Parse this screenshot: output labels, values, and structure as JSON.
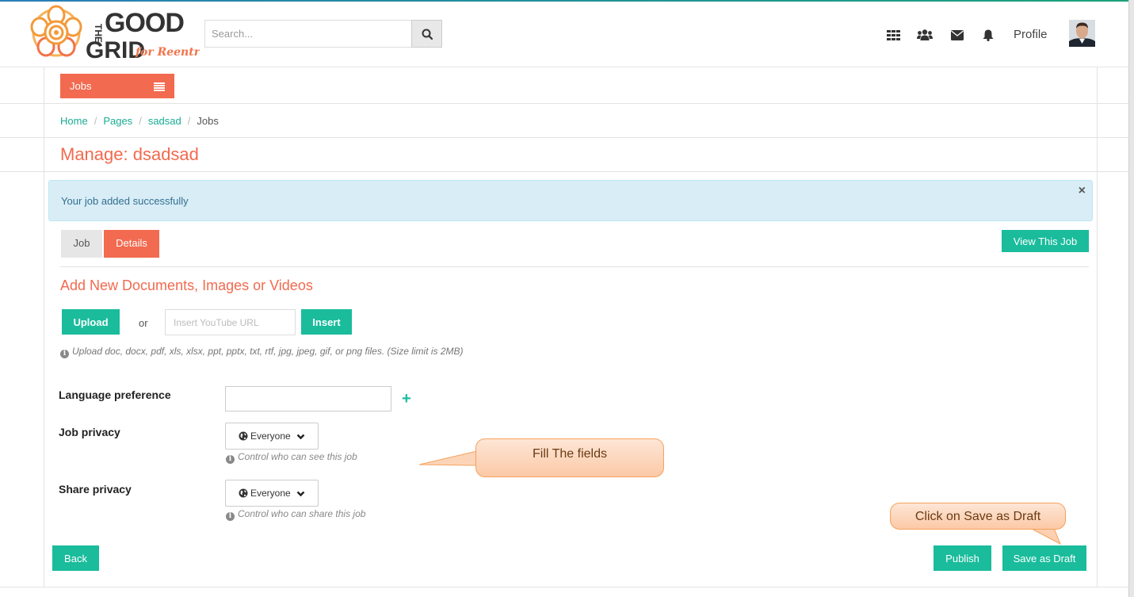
{
  "header": {
    "logo": {
      "line1": "THE",
      "line2": "GOOD",
      "line3": "GRID",
      "tagline": "for Reentry"
    },
    "search": {
      "placeholder": "Search..."
    },
    "icons": [
      "apps-grid-icon",
      "users-icon",
      "envelope-icon",
      "bell-icon",
      "search-icon"
    ],
    "profile_label": "Profile"
  },
  "menu": {
    "jobs_label": "Jobs"
  },
  "breadcrumb": {
    "home": "Home",
    "pages": "Pages",
    "page": "sadsad",
    "current": "Jobs",
    "separator": "/"
  },
  "page_title": "Manage: dsadsad",
  "alert": {
    "message": "Your job added successfully",
    "close": "×"
  },
  "tabs": {
    "job": "Job",
    "details": "Details",
    "view_button": "View This Job"
  },
  "media": {
    "title": "Add New Documents, Images or Videos",
    "upload_label": "Upload",
    "or": "or",
    "youtube_placeholder": "Insert YouTube URL",
    "insert_label": "Insert",
    "hint": "Upload doc, docx, pdf, xls, xlsx, ppt, pptx, txt, rtf, jpg, jpeg, gif, or png files. (Size limit is 2MB)"
  },
  "form": {
    "language_label": "Language preference",
    "language_value": "",
    "job_privacy_label": "Job privacy",
    "job_privacy_value": "Everyone",
    "job_privacy_hint": "Control who can see this job",
    "share_privacy_label": "Share privacy",
    "share_privacy_value": "Everyone",
    "share_privacy_hint": "Control who can share this job"
  },
  "callouts": {
    "fill": "Fill The fields",
    "draft": "Click on Save as Draft"
  },
  "actions": {
    "back": "Back",
    "publish": "Publish",
    "save_draft": "Save as Draft"
  },
  "colors": {
    "accent": "#f26a4f",
    "teal": "#1abc9c",
    "link": "#1aab94",
    "alert_bg": "#d9edf7"
  }
}
